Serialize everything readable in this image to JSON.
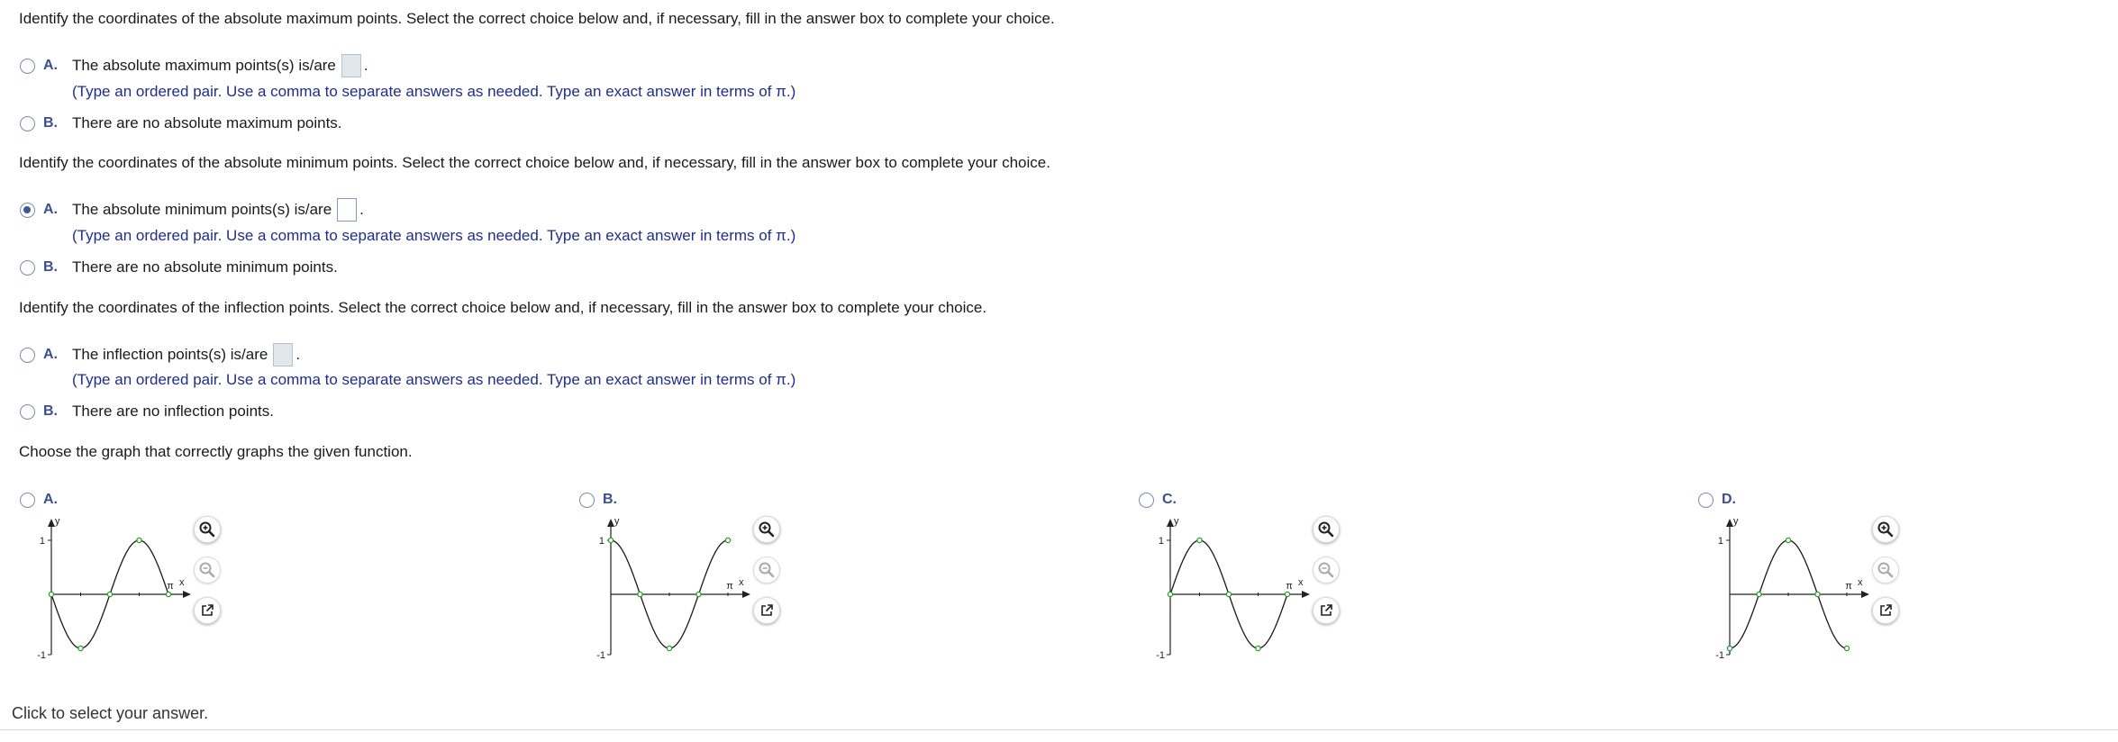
{
  "colors": {
    "accent": "#3b4f8f",
    "hint": "#1f2e8c",
    "curve": "#1a1a1a",
    "point": "#22a022"
  },
  "icons": {
    "zoom_in": "zoom-in-icon",
    "zoom_out": "zoom-out-icon",
    "popout": "open-new-window-icon"
  },
  "max_question": {
    "prompt": "Identify the coordinates of the absolute maximum points. Select the correct choice below and, if necessary, fill in the answer box to complete your choice.",
    "a_letter": "A.",
    "a_text": "The absolute maximum points(s) is/are",
    "a_after": ".",
    "hint": "(Type an ordered pair. Use a comma to separate answers as needed. Type an exact answer in terms of π.)",
    "b_letter": "B.",
    "b_text": "There are no absolute maximum points."
  },
  "min_question": {
    "prompt": "Identify the coordinates of the absolute minimum points. Select the correct choice below and, if necessary, fill in the answer box to complete your choice.",
    "a_letter": "A.",
    "a_text": "The absolute minimum points(s) is/are",
    "a_after": ".",
    "hint": "(Type an ordered pair. Use a comma to separate answers as needed. Type an exact answer in terms of π.)",
    "b_letter": "B.",
    "b_text": "There are no absolute minimum points.",
    "selected": "A"
  },
  "inflection_question": {
    "prompt": "Identify the coordinates of the inflection points. Select the correct choice below and, if necessary, fill in the answer box to complete your choice.",
    "a_letter": "A.",
    "a_text": "The inflection points(s) is/are",
    "a_after": ".",
    "hint": "(Type an ordered pair. Use a comma to separate answers as needed. Type an exact answer in terms of π.)",
    "b_letter": "B.",
    "b_text": "There are no inflection points."
  },
  "graph_question": {
    "prompt": "Choose the graph that correctly graphs the given function.",
    "options": [
      {
        "letter": "A.",
        "function": "-sin(2x)",
        "y_top": "1",
        "y_bottom": "-1",
        "x_tick": "π",
        "x_label": "x",
        "y_label": "y"
      },
      {
        "letter": "B.",
        "function": "cos(2x)",
        "y_top": "1",
        "y_bottom": "-1",
        "x_tick": "π",
        "x_label": "x",
        "y_label": "y"
      },
      {
        "letter": "C.",
        "function": "sin(2x)",
        "y_top": "1",
        "y_bottom": "-1",
        "x_tick": "π",
        "x_label": "x",
        "y_label": "y"
      },
      {
        "letter": "D.",
        "function": "-cos(2x)",
        "y_top": "1",
        "y_bottom": "-1",
        "x_tick": "π",
        "x_label": "x",
        "y_label": "y"
      }
    ]
  },
  "footer": {
    "text": "Click to select your answer."
  }
}
